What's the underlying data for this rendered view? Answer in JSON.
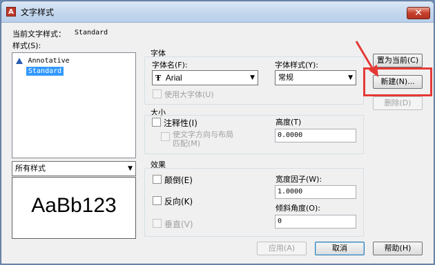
{
  "window": {
    "title": "文字样式",
    "close_glyph": "✕"
  },
  "current_style": {
    "label": "当前文字样式：",
    "value": "Standard"
  },
  "styles": {
    "label": "样式(S):",
    "items": [
      {
        "label": "Annotative",
        "icon": "annotative-icon"
      },
      {
        "label": "Standard",
        "selected": true
      }
    ]
  },
  "filter": {
    "value": "所有样式"
  },
  "preview": {
    "text": "AaBb123"
  },
  "font": {
    "group_label": "字体",
    "name_label": "字体名(F):",
    "name_value": "Arial",
    "style_label": "字体样式(Y):",
    "style_value": "常规",
    "big_font_label": "使用大字体(U)"
  },
  "size": {
    "group_label": "大小",
    "annotative_label": "注释性(I)",
    "match_orientation_label": "使文字方向与布局\n匹配(M)",
    "height_label": "高度(T)",
    "height_value": "0.0000"
  },
  "effects": {
    "group_label": "效果",
    "upside_down_label": "颠倒(E)",
    "backwards_label": "反向(K)",
    "vertical_label": "垂直(V)",
    "width_factor_label": "宽度因子(W):",
    "width_factor_value": "1.0000",
    "oblique_label": "倾斜角度(O):",
    "oblique_value": "0"
  },
  "buttons": {
    "set_current": "置为当前(C)",
    "new": "新建(N)...",
    "delete": "删除(D)",
    "apply": "应用(A)",
    "cancel": "取消",
    "help": "帮助(H)"
  },
  "annotation": {
    "color": "#e53935"
  }
}
